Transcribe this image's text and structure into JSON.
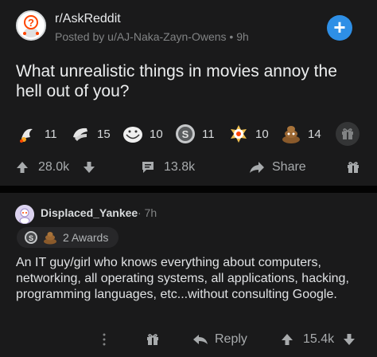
{
  "post": {
    "subreddit": "r/AskReddit",
    "meta": "Posted by u/AJ-Naka-Zayn-Owens • 9h",
    "title": "What unrealistic things in movies annoy the hell out of you?",
    "awards": [
      {
        "icon": "wholesome-award-icon",
        "count": "11"
      },
      {
        "icon": "facepalm-award-icon",
        "count": "15"
      },
      {
        "icon": "trollface-award-icon",
        "count": "10"
      },
      {
        "icon": "silver-award-icon",
        "count": "11"
      },
      {
        "icon": "all-seeing-upvote-award-icon",
        "count": "10"
      },
      {
        "icon": "poop-award-icon",
        "count": "14"
      }
    ],
    "upvotes": "28.0k",
    "comments": "13.8k",
    "share_label": "Share"
  },
  "comment": {
    "username": "Displaced_Yankee",
    "time": "· 7h",
    "awards_label": "2 Awards",
    "body": "An IT guy/girl who knows everything about computers, networking, all operating systems, all applications, hacking, programming languages, etc...without consulting Google.",
    "reply_label": "Reply",
    "upvotes": "15.4k"
  },
  "colors": {
    "background": "#1a1a1b",
    "accent_blue": "#2e8fe6",
    "text_muted": "#818384"
  }
}
